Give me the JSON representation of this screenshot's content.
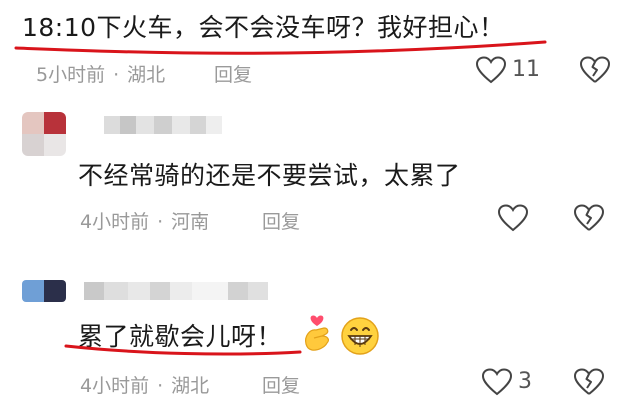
{
  "comments": [
    {
      "text": "18:10下火车，会不会没车呀？我好担心！",
      "time": "5小时前",
      "location": "湖北",
      "reply_label": "回复",
      "like_count": "11"
    },
    {
      "text": "不经常骑的还是不要尝试，太累了",
      "time": "4小时前",
      "location": "河南",
      "reply_label": "回复",
      "like_count": ""
    },
    {
      "text": "累了就歇会儿呀！",
      "time": "4小时前",
      "location": "湖北",
      "reply_label": "回复",
      "like_count": "3",
      "emojis": [
        "finger-heart-emoji",
        "grinning-face-emoji"
      ]
    }
  ],
  "separator": "·",
  "colors": {
    "underline": "#d9141b",
    "meta_text": "#999999",
    "body_text": "#1a1a1a"
  }
}
